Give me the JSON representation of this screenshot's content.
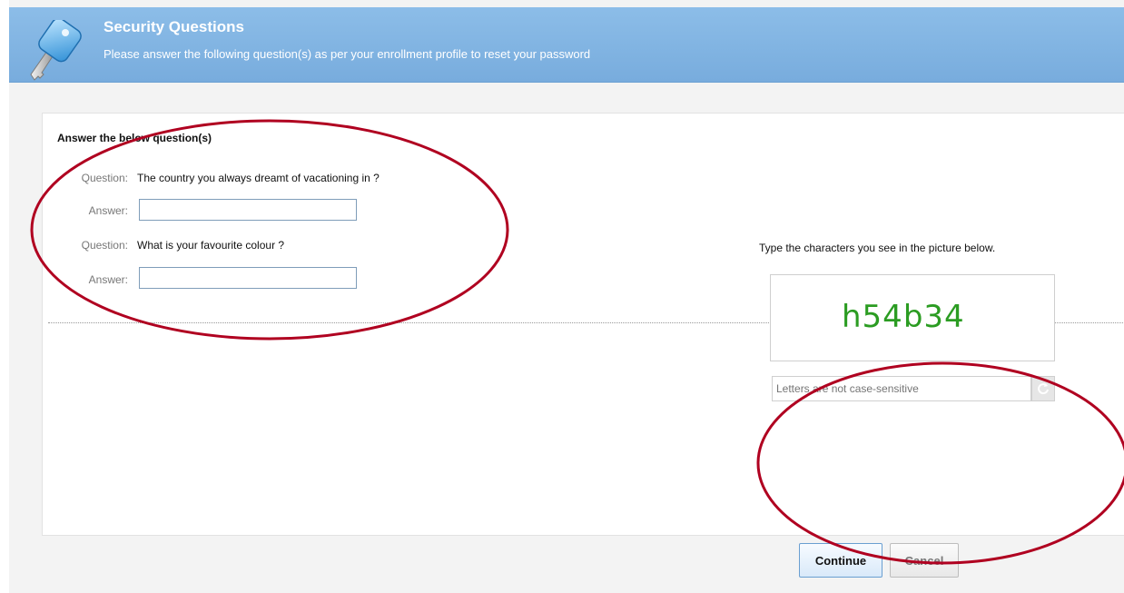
{
  "header": {
    "title": "Security Questions",
    "subtitle": "Please answer the following question(s) as per your enrollment profile to reset your password"
  },
  "form": {
    "section_title": "Answer the below question(s)",
    "question_label": "Question:",
    "answer_label": "Answer:",
    "questions": [
      {
        "text": "The country you always dreamt of vacationing in ?",
        "answer": ""
      },
      {
        "text": "What is your favourite colour ?",
        "answer": ""
      }
    ]
  },
  "captcha": {
    "prompt": "Type the characters you see in the picture below.",
    "image_text": "h54b34",
    "placeholder": "Letters are not case-sensitive",
    "value": "",
    "refresh_icon": "refresh-icon"
  },
  "buttons": {
    "continue_label": "Continue",
    "cancel_label": "Cancel"
  },
  "colors": {
    "header_bg": "#7fb2e1",
    "captcha_text": "#2b9c22",
    "annotation": "#b00020"
  }
}
